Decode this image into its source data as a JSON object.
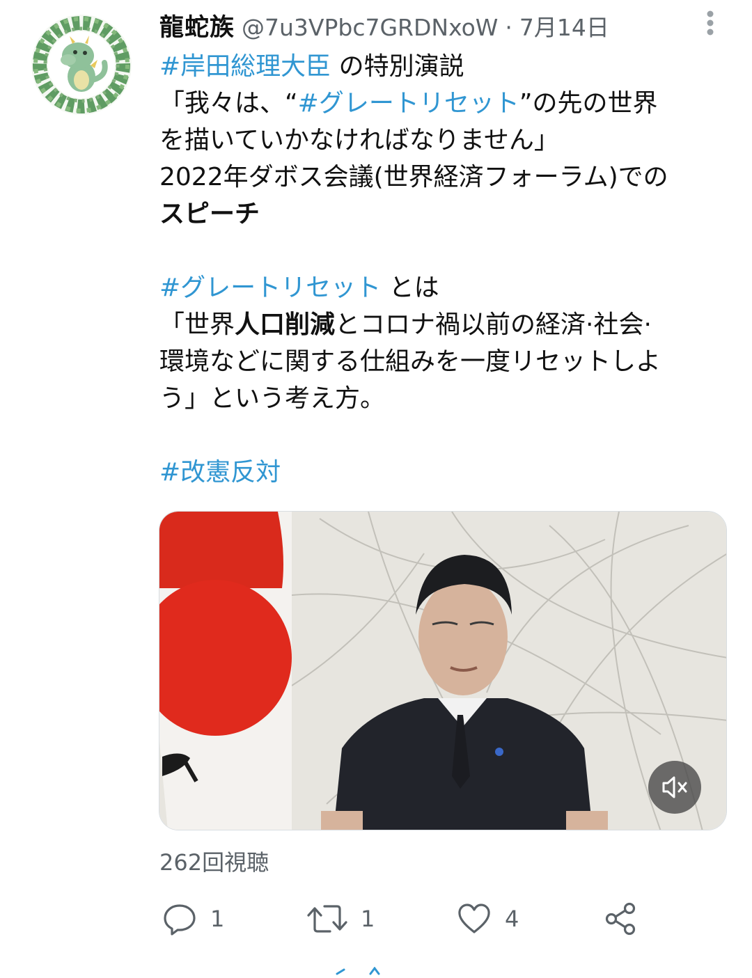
{
  "tweet": {
    "author_name": "龍蛇族",
    "handle": "@7u3VPbc7GRDNxoW",
    "separator": "·",
    "date": "7月14日",
    "more_icon": "more-vertical-icon",
    "lines": [
      {
        "segments": [
          {
            "text": "#岸田総理大臣",
            "style": "tag"
          },
          {
            "text": " の特別演説",
            "style": "plain"
          }
        ]
      },
      {
        "segments": [
          {
            "text": "「我々は、“",
            "style": "plain"
          },
          {
            "text": "#グレートリセット",
            "style": "tag"
          },
          {
            "text": "”の先の世界",
            "style": "plain"
          }
        ]
      },
      {
        "segments": [
          {
            "text": "を描いていかなければなりません」",
            "style": "plain"
          }
        ]
      },
      {
        "segments": [
          {
            "text": "2022年ダボス会議(世界経済フォーラム)での",
            "style": "plain"
          }
        ]
      },
      {
        "segments": [
          {
            "text": "スピーチ",
            "style": "bold"
          }
        ]
      },
      {
        "segments": []
      },
      {
        "segments": [
          {
            "text": "#グレートリセット",
            "style": "tag"
          },
          {
            "text": " とは",
            "style": "plain"
          }
        ]
      },
      {
        "segments": [
          {
            "text": "「世界",
            "style": "plain"
          },
          {
            "text": "人口削減",
            "style": "bold"
          },
          {
            "text": "とコロナ禍以前の経済·社会·",
            "style": "plain"
          }
        ]
      },
      {
        "segments": [
          {
            "text": "環境などに関する仕組みを一度リセットしよ",
            "style": "plain"
          }
        ]
      },
      {
        "segments": [
          {
            "text": "う」という考え方。",
            "style": "plain"
          }
        ]
      },
      {
        "segments": []
      },
      {
        "segments": [
          {
            "text": "#改憲反対",
            "style": "tag"
          }
        ]
      }
    ],
    "video": {
      "mute_icon": "volume-muted-icon"
    },
    "view_count": "262回視聴",
    "actions": {
      "reply": {
        "icon": "reply-icon",
        "count": "1"
      },
      "retweet": {
        "icon": "retweet-icon",
        "count": "1"
      },
      "like": {
        "icon": "heart-icon",
        "count": "4"
      },
      "share": {
        "icon": "share-icon"
      }
    }
  },
  "colors": {
    "hashtag": "#3096d2",
    "secondary_text": "#5b6268",
    "primary_text": "#111111"
  }
}
